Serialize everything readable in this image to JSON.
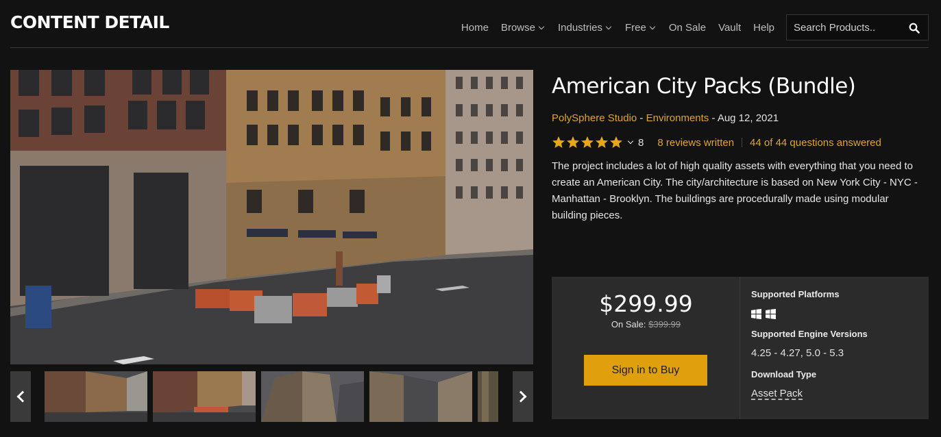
{
  "header": {
    "brand": "CONTENT DETAIL",
    "nav": [
      {
        "label": "Home",
        "dropdown": false
      },
      {
        "label": "Browse",
        "dropdown": true
      },
      {
        "label": "Industries",
        "dropdown": true
      },
      {
        "label": "Free",
        "dropdown": true
      },
      {
        "label": "On Sale",
        "dropdown": false
      },
      {
        "label": "Vault",
        "dropdown": false
      },
      {
        "label": "Help",
        "dropdown": false
      }
    ],
    "search": {
      "placeholder": "Search Products..",
      "value": "",
      "icon": "search-icon"
    }
  },
  "product": {
    "title": "American City Packs (Bundle)",
    "seller": "PolySphere Studio",
    "category": "Environments",
    "meta_sep": " - ",
    "date": "Aug 12, 2021",
    "rating_stars": 5,
    "rating_count": "8",
    "reviews": "8 reviews written",
    "questions": "44 of 44 questions answered",
    "description": "The project includes a lot of high quality assets with everything that you need to create an American City. The city/architecture is based on New York City - NYC - Manhattan - Brooklyn. The buildings are procedurally made using modular building pieces."
  },
  "purchase": {
    "price": "$299.99",
    "on_sale_label": "On Sale:",
    "original_price": "$399.99",
    "buy_button": "Sign in to Buy",
    "platforms_label": "Supported Platforms",
    "platform_icons": [
      "windows-icon",
      "windows-icon"
    ],
    "engine_label": "Supported Engine Versions",
    "engine_versions": "4.25 - 4.27, 5.0 - 5.3",
    "download_label": "Download Type",
    "download_type": "Asset Pack"
  },
  "colors": {
    "accent": "#e0a629",
    "button": "#e0a00e",
    "background": "#121212",
    "panel": "#2b2b2b"
  }
}
